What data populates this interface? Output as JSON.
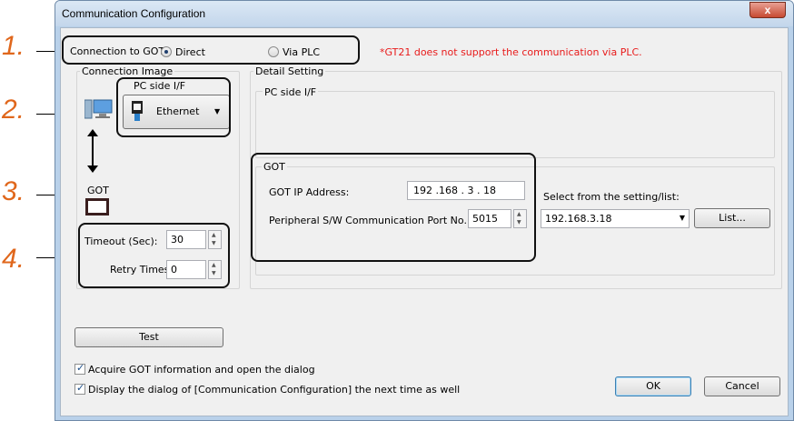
{
  "dialog": {
    "title": "Communication Configuration",
    "close_glyph": "x"
  },
  "callouts": [
    "1.",
    "2.",
    "3.",
    "4."
  ],
  "connection": {
    "label": "Connection to GOT:",
    "option_direct": "Direct",
    "option_via_plc": "Via PLC",
    "selected": "Direct",
    "note": "*GT21 does not support the communication via PLC."
  },
  "connection_image": {
    "group_label": "Connection Image",
    "pc_side_label": "PC side I/F",
    "interface_value": "Ethernet",
    "got_label": "GOT"
  },
  "timing": {
    "timeout_label": "Timeout (Sec):",
    "timeout_value": "30",
    "retry_label": "Retry Times:",
    "retry_value": "0"
  },
  "detail": {
    "group_label": "Detail Setting",
    "pc_side_label": "PC side I/F",
    "got_group_label": "GOT",
    "ip_label": "GOT IP Address:",
    "ip_value": "192 .168 .  3  . 18",
    "port_label": "Peripheral S/W Communication Port No.:",
    "port_value": "5015",
    "select_label": "Select from the setting/list:",
    "select_value": "192.168.3.18",
    "list_button": "List..."
  },
  "test_button": "Test",
  "options": {
    "acquire_label": "Acquire GOT information and open the dialog",
    "acquire_checked": true,
    "display_label": "Display the dialog of [Communication Configuration] the next time as well",
    "display_checked": true
  },
  "ok_button": "OK",
  "cancel_button": "Cancel",
  "colors": {
    "callout": "#e0671c",
    "note": "#e81b1b",
    "titlebar": "#c3d6eb"
  }
}
